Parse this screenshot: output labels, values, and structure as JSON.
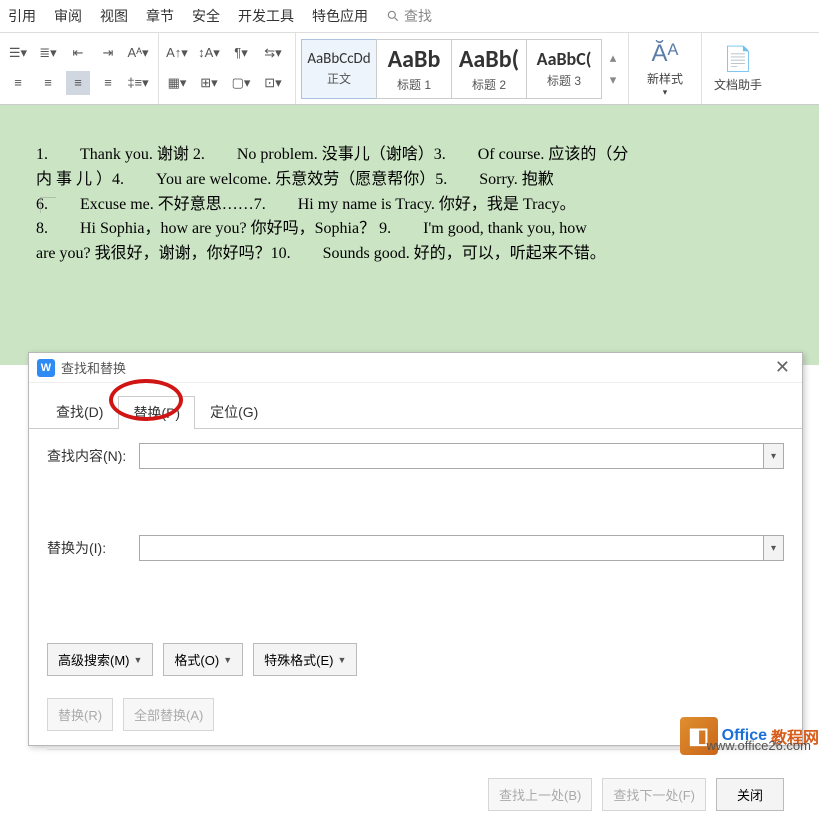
{
  "menu": {
    "items": [
      "引用",
      "审阅",
      "视图",
      "章节",
      "安全",
      "开发工具",
      "特色应用"
    ],
    "search": "查找"
  },
  "ribbon": {
    "styles": [
      {
        "preview": "AaBbCcDd",
        "name": "正文"
      },
      {
        "preview": "AaBb",
        "name": "标题 1"
      },
      {
        "preview": "AaBb(",
        "name": "标题 2"
      },
      {
        "preview": "AaBbC(",
        "name": "标题 3"
      }
    ],
    "new_style": "新样式",
    "doc_assistant": "文档助手"
  },
  "document": {
    "lines": [
      "1.　　Thank you. 谢谢 2.　　No problem. 没事儿（谢啥）3.　　Of course. 应该的（分",
      "内 事 儿 ）4.　　You are welcome. 乐意效劳（愿意帮你）5.　　Sorry. 抱歉",
      "6.　　Excuse me. 不好意思……7.　　Hi my name is Tracy. 你好，我是 Tracy。",
      "8.　　Hi Sophia，how are you? 你好吗，Sophia？ 9.　　I'm good, thank you, how",
      "are you? 我很好，谢谢，你好吗？10.　　Sounds good. 好的，可以，听起来不错。"
    ]
  },
  "dialog": {
    "title": "查找和替换",
    "tabs": {
      "find": "查找(D)",
      "replace": "替换(P)",
      "goto": "定位(G)"
    },
    "labels": {
      "find_what": "查找内容(N):",
      "replace_with": "替换为(I):"
    },
    "buttons": {
      "advanced": "高级搜索(M)",
      "format": "格式(O)",
      "special": "特殊格式(E)",
      "replace": "替换(R)",
      "replace_all": "全部替换(A)",
      "find_prev": "查找上一处(B)",
      "find_next": "查找下一处(F)",
      "close": "关闭"
    },
    "inputs": {
      "find": "",
      "replace": ""
    }
  },
  "watermark": {
    "brand1": "Office",
    "brand2": "教程网",
    "url": "www.office26.com"
  }
}
